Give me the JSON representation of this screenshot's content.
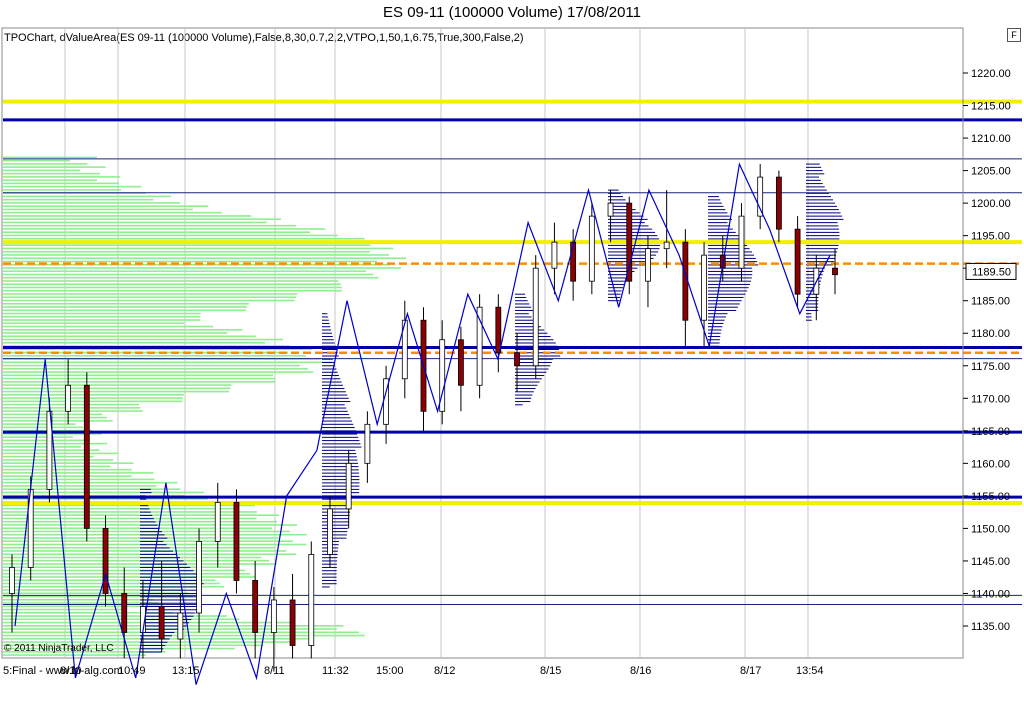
{
  "title": "ES 09-11 (100000 Volume)  17/08/2011",
  "indicator_label": "TPOChart, dValueArea(ES 09-11 (100000 Volume),False,8,30,0.7,2,2,VTPO,1,50,1,6.75,True,300,False,2)",
  "copyright": "© 2011 NinjaTrader, LLC",
  "panel_button": "F",
  "bottom_left_label": "5:Final - www.ln-alg.com",
  "colors": {
    "background": "#ffffff",
    "volume_profile": "#90ee90",
    "tpo_profile": "#000080",
    "swing_line": "#0000cd",
    "yellow_level": "#f0f000",
    "blue_level": "#0000aa",
    "poc_level": "#ff8c00",
    "candle_up": "#ffffff",
    "candle_down": "#8b0000",
    "grid": "#b0b0b0"
  },
  "chart_data": {
    "type": "candlestick",
    "title": "ES 09-11 (100000 Volume)  17/08/2011",
    "ylim": [
      1130,
      1225
    ],
    "y_ticks": [
      "1135.00",
      "1140.00",
      "1145.00",
      "1150.00",
      "1155.00",
      "1160.00",
      "1165.00",
      "1170.00",
      "1175.00",
      "1180.00",
      "1185.00",
      "1190.00",
      "1195.00",
      "1200.00",
      "1205.00",
      "1210.00",
      "1215.00",
      "1220.00"
    ],
    "x_tick_labels": [
      "8/10",
      "10:49",
      "13:15",
      "8/11",
      "11:32",
      "15:00",
      "8/12",
      "8/15",
      "8/16",
      "8/17",
      "13:54"
    ],
    "last_price": "1189.50",
    "grid": true,
    "horizontal_levels": [
      {
        "price": 1215.6,
        "color": "yellow"
      },
      {
        "price": 1212.8,
        "color": "blue"
      },
      {
        "price": 1206.8,
        "color": "thin-blue"
      },
      {
        "price": 1201.6,
        "color": "thin-blue"
      },
      {
        "price": 1194.0,
        "color": "yellow"
      },
      {
        "price": 1190.7,
        "color": "orange-dashed"
      },
      {
        "price": 1177.8,
        "color": "blue"
      },
      {
        "price": 1177.0,
        "color": "orange-dashed"
      },
      {
        "price": 1176.1,
        "color": "thin-blue"
      },
      {
        "price": 1164.8,
        "color": "blue"
      },
      {
        "price": 1154.8,
        "color": "blue"
      },
      {
        "price": 1153.9,
        "color": "yellow"
      },
      {
        "price": 1139.7,
        "color": "thin-blue"
      },
      {
        "price": 1138.3,
        "color": "thin-blue"
      }
    ],
    "swing_points": [
      1135,
      1176,
      1127,
      1143,
      1127,
      1157,
      1126,
      1140,
      1127,
      1155,
      1162,
      1185,
      1166,
      1183,
      1168,
      1186,
      1176,
      1197,
      1185,
      1202,
      1184,
      1202,
      1192,
      1178,
      1206,
      1196,
      1183,
      1192
    ],
    "candles_approx": [
      {
        "o": 1140,
        "h": 1146,
        "l": 1134,
        "c": 1144
      },
      {
        "o": 1144,
        "h": 1158,
        "l": 1142,
        "c": 1156
      },
      {
        "o": 1156,
        "h": 1170,
        "l": 1154,
        "c": 1168
      },
      {
        "o": 1168,
        "h": 1176,
        "l": 1166,
        "c": 1172
      },
      {
        "o": 1172,
        "h": 1174,
        "l": 1148,
        "c": 1150
      },
      {
        "o": 1150,
        "h": 1152,
        "l": 1138,
        "c": 1140
      },
      {
        "o": 1140,
        "h": 1144,
        "l": 1130,
        "c": 1134
      },
      {
        "o": 1134,
        "h": 1142,
        "l": 1130,
        "c": 1138
      },
      {
        "o": 1138,
        "h": 1145,
        "l": 1131,
        "c": 1133
      },
      {
        "o": 1133,
        "h": 1140,
        "l": 1130,
        "c": 1137
      },
      {
        "o": 1137,
        "h": 1150,
        "l": 1134,
        "c": 1148
      },
      {
        "o": 1148,
        "h": 1157,
        "l": 1144,
        "c": 1154
      },
      {
        "o": 1154,
        "h": 1156,
        "l": 1140,
        "c": 1142
      },
      {
        "o": 1142,
        "h": 1145,
        "l": 1130,
        "c": 1134
      },
      {
        "o": 1134,
        "h": 1141,
        "l": 1128,
        "c": 1139
      },
      {
        "o": 1139,
        "h": 1143,
        "l": 1130,
        "c": 1132
      },
      {
        "o": 1132,
        "h": 1148,
        "l": 1130,
        "c": 1146
      },
      {
        "o": 1146,
        "h": 1155,
        "l": 1144,
        "c": 1153
      },
      {
        "o": 1153,
        "h": 1162,
        "l": 1150,
        "c": 1160
      },
      {
        "o": 1160,
        "h": 1168,
        "l": 1157,
        "c": 1166
      },
      {
        "o": 1166,
        "h": 1175,
        "l": 1163,
        "c": 1173
      },
      {
        "o": 1173,
        "h": 1185,
        "l": 1170,
        "c": 1182
      },
      {
        "o": 1182,
        "h": 1184,
        "l": 1165,
        "c": 1168
      },
      {
        "o": 1168,
        "h": 1182,
        "l": 1166,
        "c": 1179
      },
      {
        "o": 1179,
        "h": 1181,
        "l": 1168,
        "c": 1172
      },
      {
        "o": 1172,
        "h": 1186,
        "l": 1170,
        "c": 1184
      },
      {
        "o": 1184,
        "h": 1186,
        "l": 1174,
        "c": 1177
      },
      {
        "o": 1177,
        "h": 1180,
        "l": 1171,
        "c": 1175
      },
      {
        "o": 1175,
        "h": 1192,
        "l": 1173,
        "c": 1190
      },
      {
        "o": 1190,
        "h": 1197,
        "l": 1186,
        "c": 1194
      },
      {
        "o": 1194,
        "h": 1196,
        "l": 1185,
        "c": 1188
      },
      {
        "o": 1188,
        "h": 1200,
        "l": 1186,
        "c": 1198
      },
      {
        "o": 1198,
        "h": 1202,
        "l": 1194,
        "c": 1200
      },
      {
        "o": 1200,
        "h": 1201,
        "l": 1186,
        "c": 1188
      },
      {
        "o": 1188,
        "h": 1195,
        "l": 1184,
        "c": 1193
      },
      {
        "o": 1193,
        "h": 1202,
        "l": 1190,
        "c": 1194
      },
      {
        "o": 1194,
        "h": 1196,
        "l": 1178,
        "c": 1182
      },
      {
        "o": 1182,
        "h": 1194,
        "l": 1178,
        "c": 1192
      },
      {
        "o": 1192,
        "h": 1195,
        "l": 1188,
        "c": 1190
      },
      {
        "o": 1190,
        "h": 1200,
        "l": 1188,
        "c": 1198
      },
      {
        "o": 1198,
        "h": 1206,
        "l": 1196,
        "c": 1204
      },
      {
        "o": 1204,
        "h": 1205,
        "l": 1194,
        "c": 1196
      },
      {
        "o": 1196,
        "h": 1198,
        "l": 1184,
        "c": 1186
      },
      {
        "o": 1186,
        "h": 1192,
        "l": 1182,
        "c": 1190
      },
      {
        "o": 1190,
        "h": 1193,
        "l": 1186,
        "c": 1189
      }
    ]
  }
}
